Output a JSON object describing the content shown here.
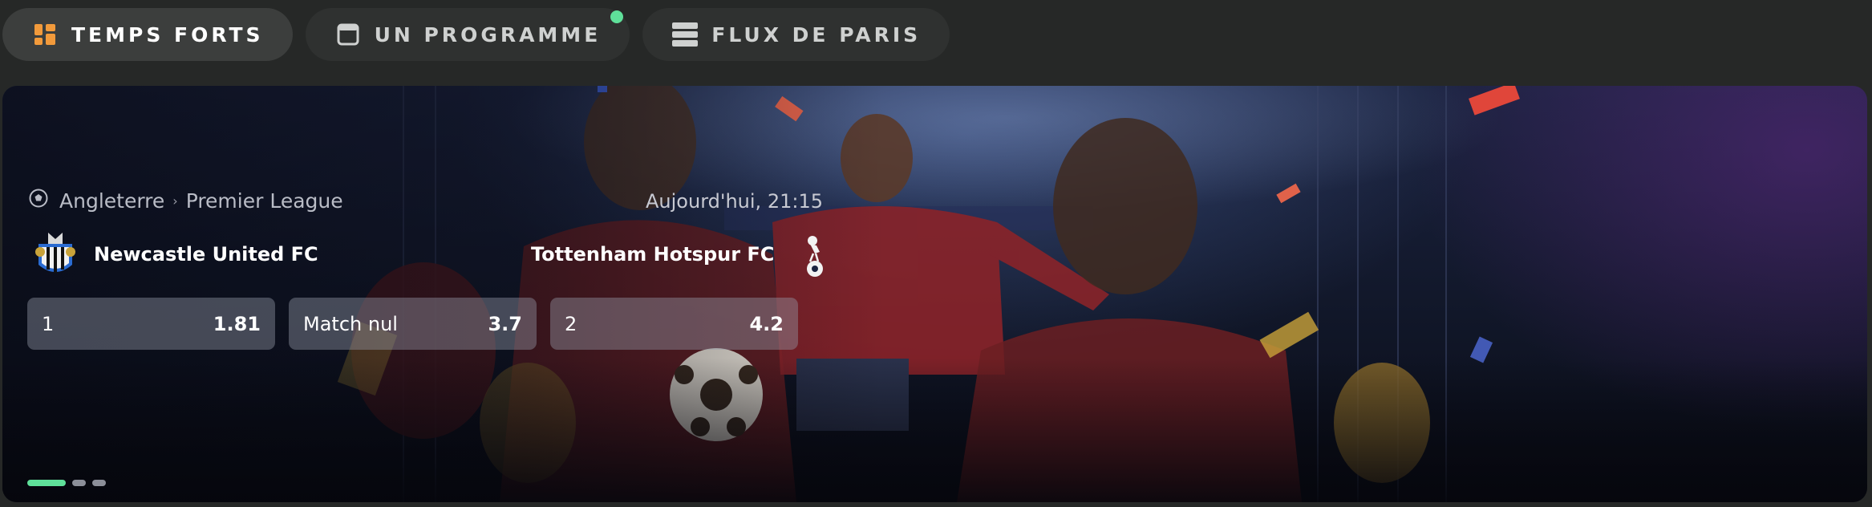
{
  "tabs": [
    {
      "label": "TEMPS FORTS",
      "icon": "highlights-icon",
      "active": true
    },
    {
      "label": "UN PROGRAMME",
      "icon": "calendar-icon",
      "active": false,
      "has_new_indicator": true
    },
    {
      "label": "FLUX DE PARIS",
      "icon": "feed-icon",
      "active": false
    }
  ],
  "event": {
    "sport_icon": "soccer-ball-icon",
    "country": "Angleterre",
    "separator": "›",
    "league": "Premier League",
    "kickoff": "Aujourd'hui, 21:15",
    "home_team": "Newcastle United FC",
    "away_team": "Tottenham Hotspur FC",
    "odds": [
      {
        "label": "1",
        "value": "1.81"
      },
      {
        "label": "Match nul",
        "value": "3.7"
      },
      {
        "label": "2",
        "value": "4.2"
      }
    ]
  },
  "carousel": {
    "pages": 3,
    "current": 1
  },
  "colors": {
    "accent": "#5fe09a",
    "tab_icon_active": "#f29a3b",
    "background": "#262827"
  }
}
